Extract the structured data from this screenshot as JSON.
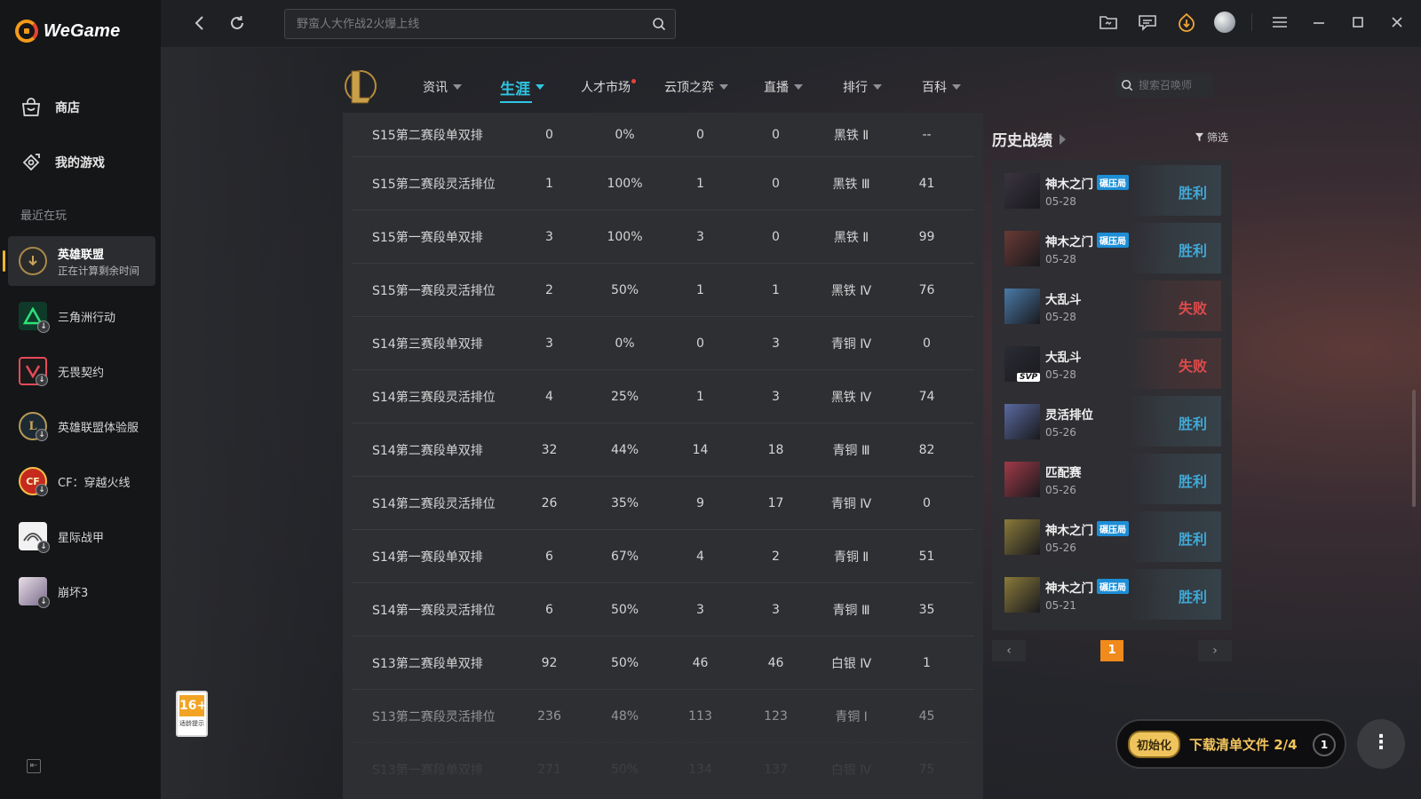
{
  "app": {
    "name": "WeGame"
  },
  "sidebar": {
    "nav": [
      {
        "label": "商店",
        "icon": "store-icon"
      },
      {
        "label": "我的游戏",
        "icon": "games-icon"
      }
    ],
    "recent_label": "最近在玩",
    "games": [
      {
        "name": "英雄联盟",
        "sub": "正在计算剩余时间",
        "icon": "lol-icon",
        "active": true
      },
      {
        "name": "三角洲行动",
        "icon": "delta-force-icon"
      },
      {
        "name": "无畏契约",
        "icon": "valorant-icon"
      },
      {
        "name": "英雄联盟体验服",
        "icon": "lol-pbe-icon"
      },
      {
        "name": "CF：穿越火线",
        "icon": "crossfire-icon"
      },
      {
        "name": "星际战甲",
        "icon": "warframe-icon"
      },
      {
        "name": "崩坏3",
        "icon": "honkai3-icon"
      }
    ]
  },
  "topbar": {
    "search_placeholder": "野蛮人大作战2火爆上线"
  },
  "game_nav": {
    "items": [
      {
        "label": "资讯",
        "caret": true
      },
      {
        "label": "生涯",
        "caret": true,
        "active": true
      },
      {
        "label": "人才市场",
        "dot": true
      },
      {
        "label": "云顶之弈",
        "caret": true
      },
      {
        "label": "直播",
        "caret": true
      },
      {
        "label": "排行",
        "caret": true
      },
      {
        "label": "百科",
        "caret": true
      }
    ],
    "summoner_search_placeholder": "搜索召唤师"
  },
  "ranked_table": {
    "rows": [
      [
        "S15第二赛段单双排",
        "0",
        "0%",
        "0",
        "0",
        "黑铁 Ⅱ",
        "--"
      ],
      [
        "S15第二赛段灵活排位",
        "1",
        "100%",
        "1",
        "0",
        "黑铁 Ⅲ",
        "41"
      ],
      [
        "S15第一赛段单双排",
        "3",
        "100%",
        "3",
        "0",
        "黑铁 Ⅱ",
        "99"
      ],
      [
        "S15第一赛段灵活排位",
        "2",
        "50%",
        "1",
        "1",
        "黑铁 Ⅳ",
        "76"
      ],
      [
        "S14第三赛段单双排",
        "3",
        "0%",
        "0",
        "3",
        "青铜 Ⅳ",
        "0"
      ],
      [
        "S14第三赛段灵活排位",
        "4",
        "25%",
        "1",
        "3",
        "黑铁 Ⅳ",
        "74"
      ],
      [
        "S14第二赛段单双排",
        "32",
        "44%",
        "14",
        "18",
        "青铜 Ⅲ",
        "82"
      ],
      [
        "S14第二赛段灵活排位",
        "26",
        "35%",
        "9",
        "17",
        "青铜 Ⅳ",
        "0"
      ],
      [
        "S14第一赛段单双排",
        "6",
        "67%",
        "4",
        "2",
        "青铜 Ⅱ",
        "51"
      ],
      [
        "S14第一赛段灵活排位",
        "6",
        "50%",
        "3",
        "3",
        "青铜 Ⅲ",
        "35"
      ],
      [
        "S13第二赛段单双排",
        "92",
        "50%",
        "46",
        "46",
        "白银 Ⅳ",
        "1"
      ],
      [
        "S13第二赛段灵活排位",
        "236",
        "48%",
        "113",
        "123",
        "青铜 Ⅰ",
        "45"
      ],
      [
        "S13第一赛段单双排",
        "271",
        "50%",
        "134",
        "137",
        "白银 Ⅳ",
        "75"
      ]
    ]
  },
  "history": {
    "title": "历史战绩",
    "filter_label": "筛选",
    "matches": [
      {
        "mode": "神木之门",
        "tag": "碾压局",
        "date": "05-28",
        "result": "胜利",
        "win": true,
        "champ_color": "#3a3440"
      },
      {
        "mode": "神木之门",
        "tag": "碾压局",
        "date": "05-28",
        "result": "胜利",
        "win": true,
        "champ_color": "#6a3a35"
      },
      {
        "mode": "大乱斗",
        "tag": "",
        "date": "05-28",
        "result": "失败",
        "win": false,
        "champ_color": "#4a7aa8"
      },
      {
        "mode": "大乱斗",
        "tag": "",
        "date": "05-28",
        "result": "失败",
        "win": false,
        "champ_color": "#2a2c34",
        "svp": "SVP"
      },
      {
        "mode": "灵活排位",
        "tag": "",
        "date": "05-26",
        "result": "胜利",
        "win": true,
        "champ_color": "#5a6aa0"
      },
      {
        "mode": "匹配赛",
        "tag": "",
        "date": "05-26",
        "result": "胜利",
        "win": true,
        "champ_color": "#a03a48"
      },
      {
        "mode": "神木之门",
        "tag": "碾压局",
        "date": "05-26",
        "result": "胜利",
        "win": true,
        "champ_color": "#8a7a3a"
      },
      {
        "mode": "神木之门",
        "tag": "碾压局",
        "date": "05-21",
        "result": "胜利",
        "win": true,
        "champ_color": "#8a7a3a"
      }
    ],
    "page": "1"
  },
  "age_rating": {
    "num": "16+",
    "label": "适龄提示"
  },
  "download": {
    "badge": "初始化",
    "text": "下载清单文件 2/4",
    "count": "1"
  },
  "colors": {
    "accent": "#2fc6e3",
    "win": "#41a8d6",
    "loss": "#de4b4b",
    "page_active": "#f08a1c"
  }
}
